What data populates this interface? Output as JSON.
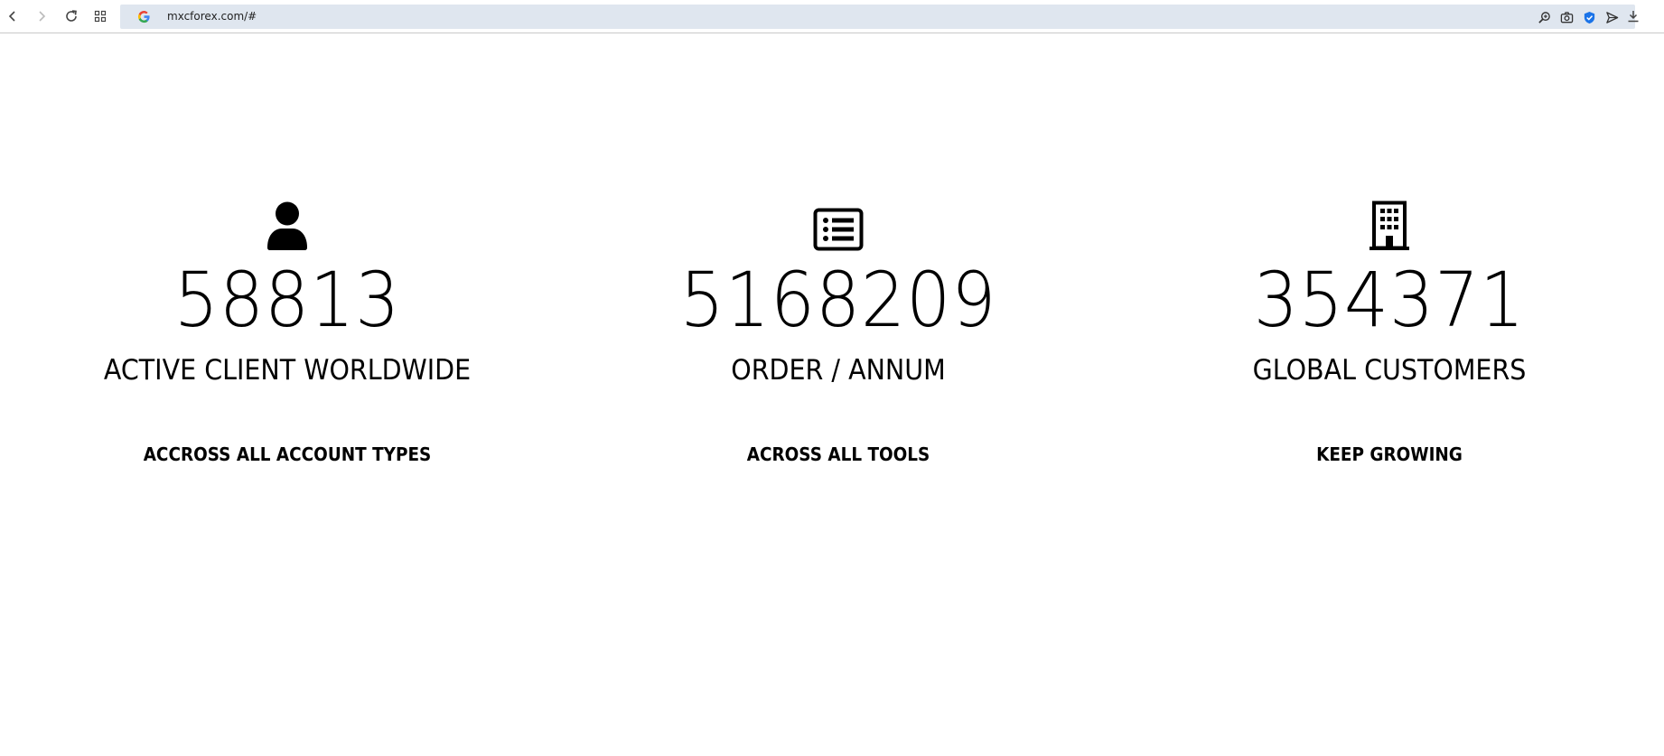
{
  "browser": {
    "url": "mxcforex.com/#",
    "icons": {
      "back": "chevron-left-icon",
      "forward": "chevron-right-icon",
      "reload": "reload-icon",
      "apps": "grid-icon",
      "search_engine": "google-icon",
      "zoom": "zoom-icon",
      "screenshot": "camera-icon",
      "shield": "shield-check-icon",
      "send": "send-icon",
      "download": "download-icon"
    },
    "accent": "#1a73e8"
  },
  "stats": [
    {
      "icon": "user-icon",
      "number": "58813",
      "label": "ACTIVE CLIENT WORLDWIDE",
      "sub": "ACCROSS ALL ACCOUNT TYPES"
    },
    {
      "icon": "list-icon",
      "number": "5168209",
      "label": "ORDER / ANNUM",
      "sub": "ACROSS ALL TOOLS"
    },
    {
      "icon": "building-icon",
      "number": "354371",
      "label": "GLOBAL CUSTOMERS",
      "sub": "KEEP GROWING"
    }
  ]
}
